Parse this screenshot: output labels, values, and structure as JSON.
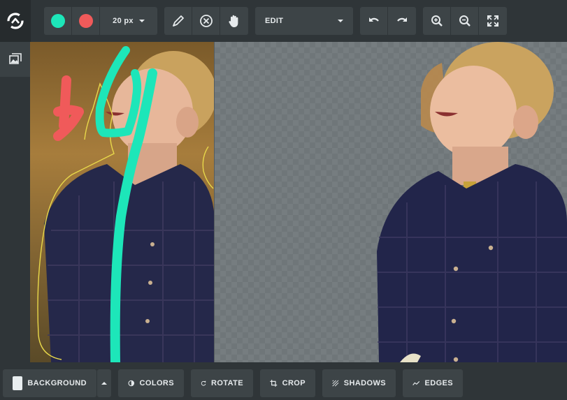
{
  "toolbar": {
    "brush_size": "20 px",
    "mode": "EDIT",
    "keep_color": "#1de6b9",
    "remove_color": "#f05a5a"
  },
  "bottom": {
    "background": "BACKGROUND",
    "colors": "COLORS",
    "rotate": "ROTATE",
    "crop": "CROP",
    "shadows": "SHADOWS",
    "edges": "EDGES"
  },
  "icons": {
    "logo": "logo-icon",
    "keep": "keep-brush-icon",
    "remove": "remove-brush-icon",
    "pencil": "pencil-icon",
    "erase": "close-circle-icon",
    "pan": "hand-icon",
    "undo": "undo-icon",
    "redo": "redo-icon",
    "zoom_in": "zoom-in-icon",
    "zoom_out": "zoom-out-icon",
    "fit": "fullscreen-icon",
    "image": "image-icon"
  }
}
